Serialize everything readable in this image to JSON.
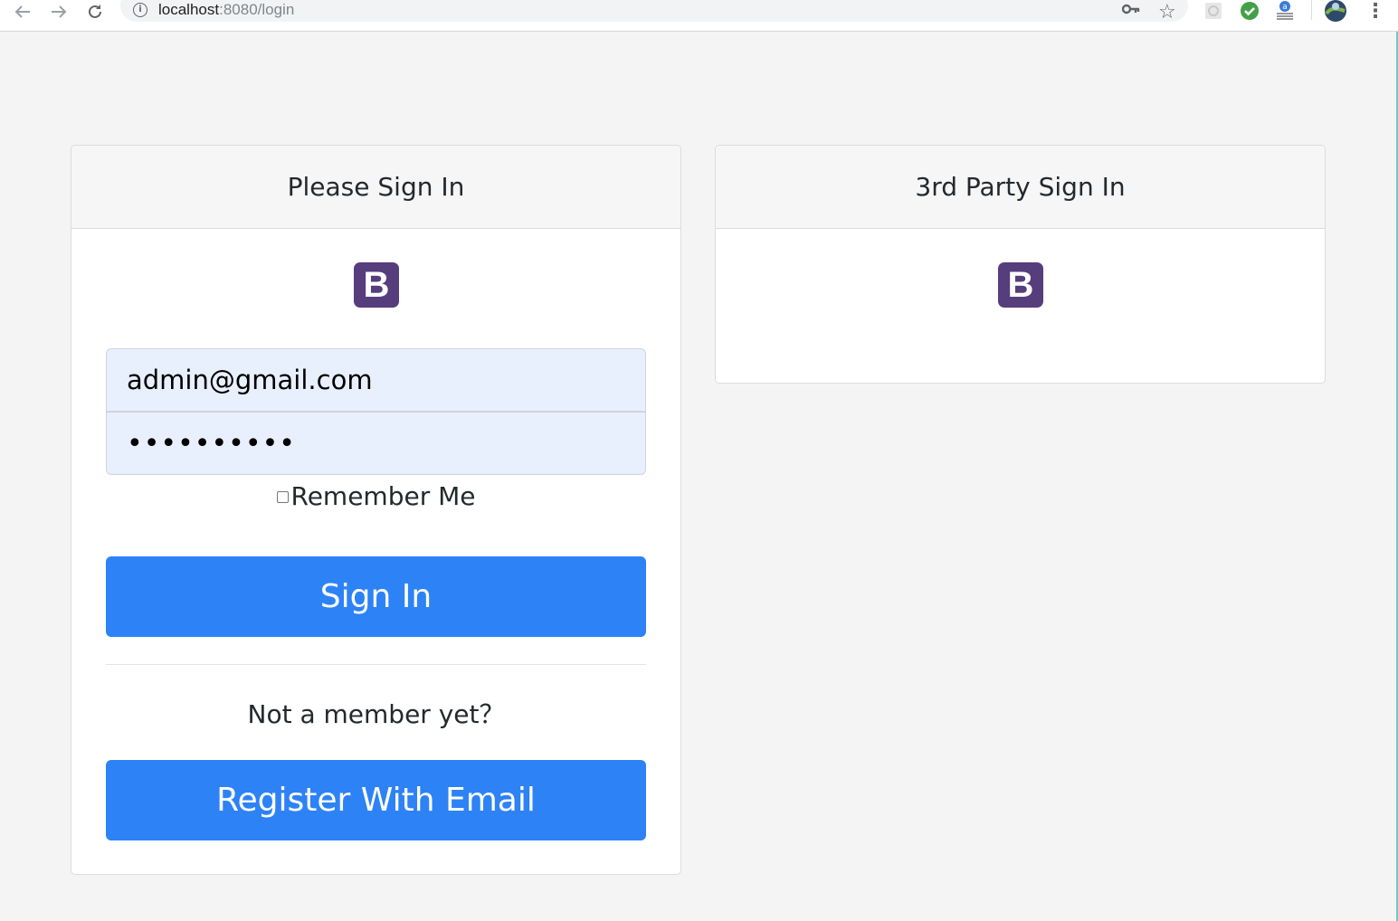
{
  "browser": {
    "url_host": "localhost",
    "url_path": ":8080/login",
    "back_icon": "arrow-left",
    "forward_icon": "arrow-right",
    "reload_icon": "reload",
    "info_icon": "i",
    "key_icon": "key",
    "star_icon": "☆",
    "menu_icon": "⋮"
  },
  "sign_in_card": {
    "title": "Please Sign In",
    "logo_letter": "B",
    "email_value": "admin@gmail.com",
    "password_mask": "••••••••••",
    "remember_label": "Remember Me",
    "remember_checked": false,
    "sign_in_label": "Sign In",
    "not_member_text": "Not a member yet？",
    "register_label": "Register With Email"
  },
  "third_party_card": {
    "title": "3rd Party Sign In",
    "logo_letter": "B"
  },
  "colors": {
    "primary_button": "#2d82f6",
    "logo_purple": "#563d7c",
    "autofill_background": "#e8f0fe",
    "page_background": "#f4f4f4"
  }
}
